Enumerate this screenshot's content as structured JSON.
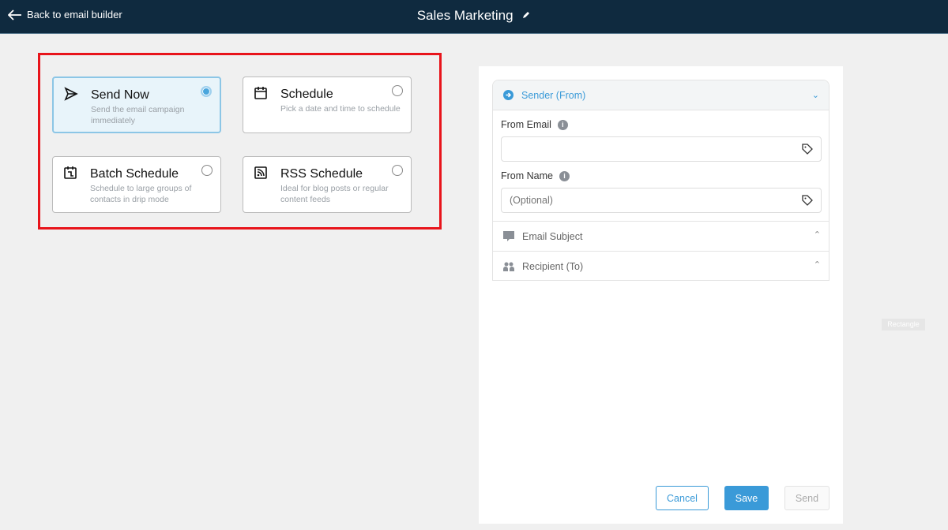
{
  "header": {
    "back_label": "Back to email builder",
    "title": "Sales Marketing"
  },
  "options": [
    {
      "title": "Send Now",
      "desc": "Send the email campaign immediately",
      "selected": true
    },
    {
      "title": "Schedule",
      "desc": "Pick a date and time to schedule",
      "selected": false
    },
    {
      "title": "Batch Schedule",
      "desc": "Schedule to large groups of contacts in drip mode",
      "selected": false
    },
    {
      "title": "RSS Schedule",
      "desc": "Ideal for blog posts or regular content feeds",
      "selected": false
    }
  ],
  "panel": {
    "sender_title": "Sender (From)",
    "from_email_label": "From Email",
    "from_email_value": "",
    "from_name_label": "From Name",
    "from_name_placeholder": "(Optional)",
    "email_subject": "Email Subject",
    "recipient": "Recipient (To)"
  },
  "buttons": {
    "cancel": "Cancel",
    "save": "Save",
    "send": "Send"
  },
  "overlay_label": "Rectangle",
  "colors": {
    "header": "#0f2a3f",
    "accent": "#3a9ad8",
    "highlight": "#e8141b"
  }
}
